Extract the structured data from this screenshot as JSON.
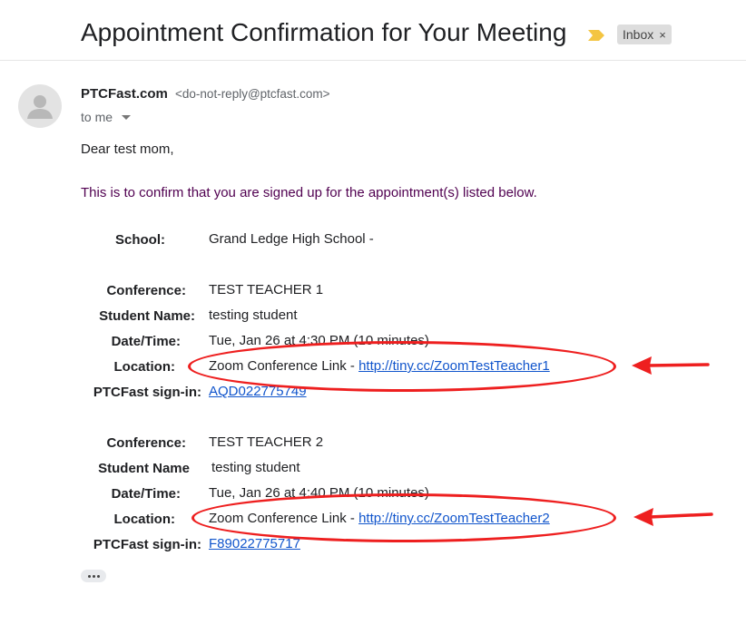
{
  "subject": "Appointment Confirmation for Your Meeting",
  "label": {
    "text": "Inbox",
    "remove": "×"
  },
  "sender": {
    "name": "PTCFast.com",
    "email": "<do-not-reply@ptcfast.com>",
    "to": "to me"
  },
  "body": {
    "greeting": "Dear test mom,",
    "confirm": "This is to confirm that you are signed up for the appointment(s) listed below.",
    "school_label": "School:",
    "school_value": "Grand Ledge High School -",
    "appointments": [
      {
        "conf_label": "Conference:",
        "conf_value": "TEST TEACHER 1",
        "student_label": "Student Name:",
        "student_value": "testing student",
        "date_label": "Date/Time:",
        "date_value": "Tue, Jan 26 at 4:30 PM (10 minutes)",
        "loc_label": "Location:",
        "loc_text": "Zoom Conference Link - ",
        "loc_link": "http://tiny.cc/ZoomTestTeacher1",
        "signin_label": "PTCFast sign-in:",
        "signin_value": "AQD022775749"
      },
      {
        "conf_label": "Conference:",
        "conf_value": "TEST TEACHER 2",
        "student_label": "Student Name",
        "student_value": "testing student",
        "date_label": "Date/Time:",
        "date_value": "Tue, Jan 26 at 4:40 PM (10 minutes)",
        "loc_label": "Location:",
        "loc_text": "Zoom Conference Link - ",
        "loc_link": "http://tiny.cc/ZoomTestTeacher2",
        "signin_label": "PTCFast sign-in:",
        "signin_value": "F89022775717"
      }
    ]
  },
  "colors": {
    "annotation": "#ee1f1f",
    "link": "#1155cc",
    "confirm_text": "#500050",
    "important_marker": "#f4c542"
  },
  "icons": {
    "important": "important-marker-icon",
    "avatar": "default-avatar-icon",
    "caret": "chevron-down-icon",
    "more": "ellipsis-icon"
  }
}
